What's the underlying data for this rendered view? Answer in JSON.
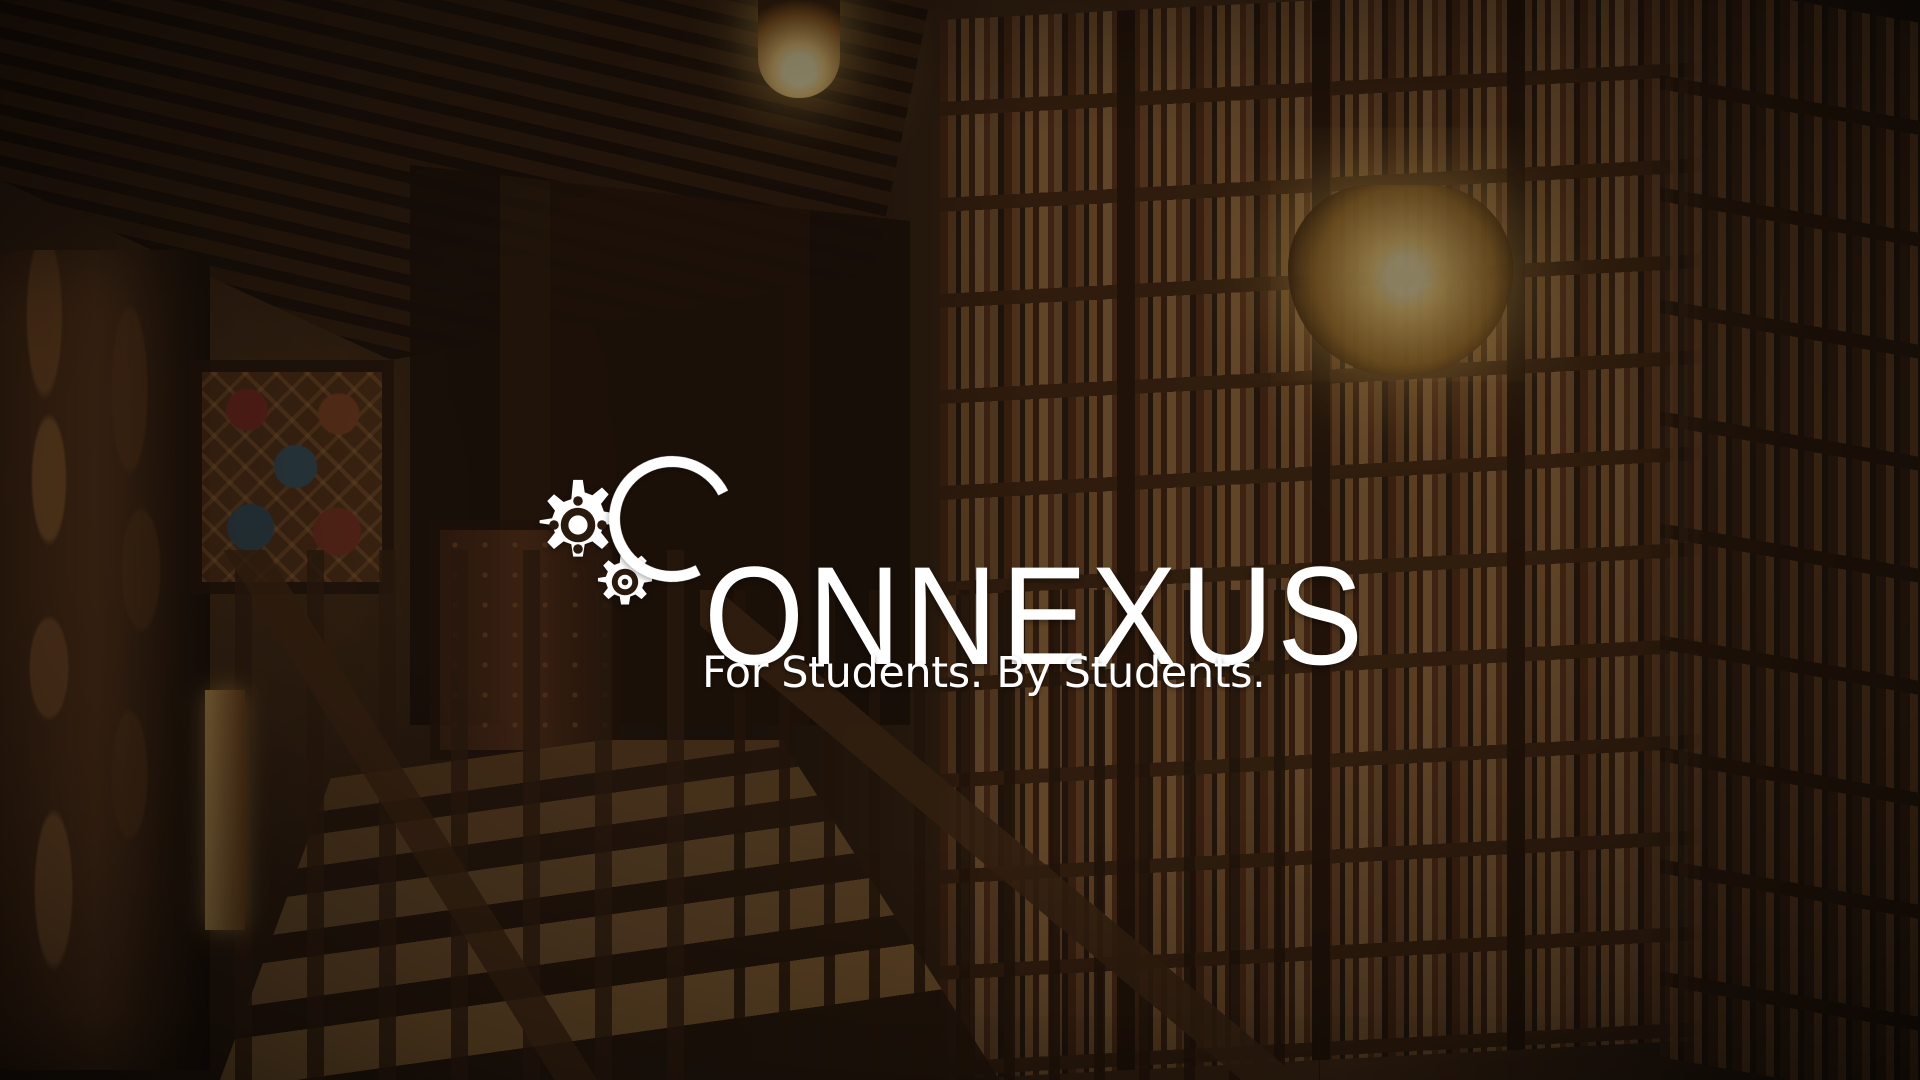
{
  "brand": {
    "name": "ONNEXUS",
    "tagline": "For Students. By Students."
  },
  "background": {
    "scene": "warmly lit library with staircase and bookshelves"
  },
  "icons": {
    "gears": "gear-icon"
  },
  "colors": {
    "logo": "#ffffff",
    "overlay": "#120c08",
    "warm_light": "#ffd77c"
  }
}
